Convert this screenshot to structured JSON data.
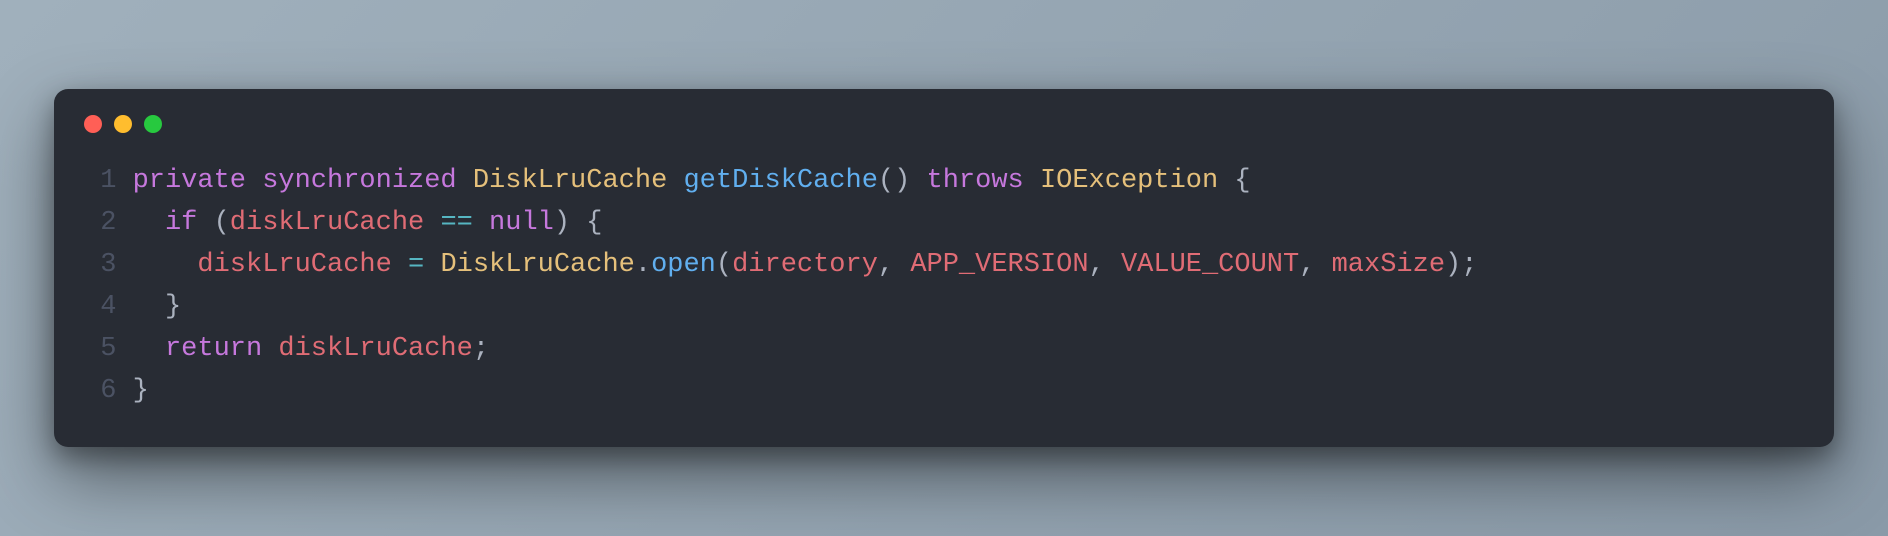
{
  "window": {
    "traffic_lights": [
      "close",
      "minimize",
      "zoom"
    ]
  },
  "code": {
    "language": "java",
    "lines": [
      {
        "n": "1",
        "indent": "",
        "tokens": [
          {
            "t": "private",
            "c": "keyword"
          },
          {
            "t": " ",
            "c": "plain"
          },
          {
            "t": "synchronized",
            "c": "keyword"
          },
          {
            "t": " ",
            "c": "plain"
          },
          {
            "t": "DiskLruCache",
            "c": "type"
          },
          {
            "t": " ",
            "c": "plain"
          },
          {
            "t": "getDiskCache",
            "c": "funcdef"
          },
          {
            "t": "()",
            "c": "punct"
          },
          {
            "t": " ",
            "c": "plain"
          },
          {
            "t": "throws",
            "c": "keyword"
          },
          {
            "t": " ",
            "c": "plain"
          },
          {
            "t": "IOException",
            "c": "type"
          },
          {
            "t": " ",
            "c": "plain"
          },
          {
            "t": "{",
            "c": "punct"
          }
        ]
      },
      {
        "n": "2",
        "indent": "  ",
        "tokens": [
          {
            "t": "if",
            "c": "keyword"
          },
          {
            "t": " ",
            "c": "plain"
          },
          {
            "t": "(",
            "c": "punct"
          },
          {
            "t": "diskLruCache",
            "c": "ident"
          },
          {
            "t": " ",
            "c": "plain"
          },
          {
            "t": "==",
            "c": "op"
          },
          {
            "t": " ",
            "c": "plain"
          },
          {
            "t": "null",
            "c": "keyword"
          },
          {
            "t": ")",
            "c": "punct"
          },
          {
            "t": " ",
            "c": "plain"
          },
          {
            "t": "{",
            "c": "punct"
          }
        ]
      },
      {
        "n": "3",
        "indent": "    ",
        "tokens": [
          {
            "t": "diskLruCache",
            "c": "ident"
          },
          {
            "t": " ",
            "c": "plain"
          },
          {
            "t": "=",
            "c": "op"
          },
          {
            "t": " ",
            "c": "plain"
          },
          {
            "t": "DiskLruCache",
            "c": "type"
          },
          {
            "t": ".",
            "c": "punct"
          },
          {
            "t": "open",
            "c": "funccall"
          },
          {
            "t": "(",
            "c": "punct"
          },
          {
            "t": "directory",
            "c": "ident"
          },
          {
            "t": ",",
            "c": "punct"
          },
          {
            "t": " ",
            "c": "plain"
          },
          {
            "t": "APP_VERSION",
            "c": "const"
          },
          {
            "t": ",",
            "c": "punct"
          },
          {
            "t": " ",
            "c": "plain"
          },
          {
            "t": "VALUE_COUNT",
            "c": "const"
          },
          {
            "t": ",",
            "c": "punct"
          },
          {
            "t": " ",
            "c": "plain"
          },
          {
            "t": "maxSize",
            "c": "ident"
          },
          {
            "t": ")",
            "c": "punct"
          },
          {
            "t": ";",
            "c": "punct"
          }
        ]
      },
      {
        "n": "4",
        "indent": "  ",
        "tokens": [
          {
            "t": "}",
            "c": "punct"
          }
        ]
      },
      {
        "n": "5",
        "indent": "  ",
        "tokens": [
          {
            "t": "return",
            "c": "keyword"
          },
          {
            "t": " ",
            "c": "plain"
          },
          {
            "t": "diskLruCache",
            "c": "ident"
          },
          {
            "t": ";",
            "c": "punct"
          }
        ]
      },
      {
        "n": "6",
        "indent": "",
        "tokens": [
          {
            "t": "}",
            "c": "punct"
          }
        ]
      }
    ]
  }
}
